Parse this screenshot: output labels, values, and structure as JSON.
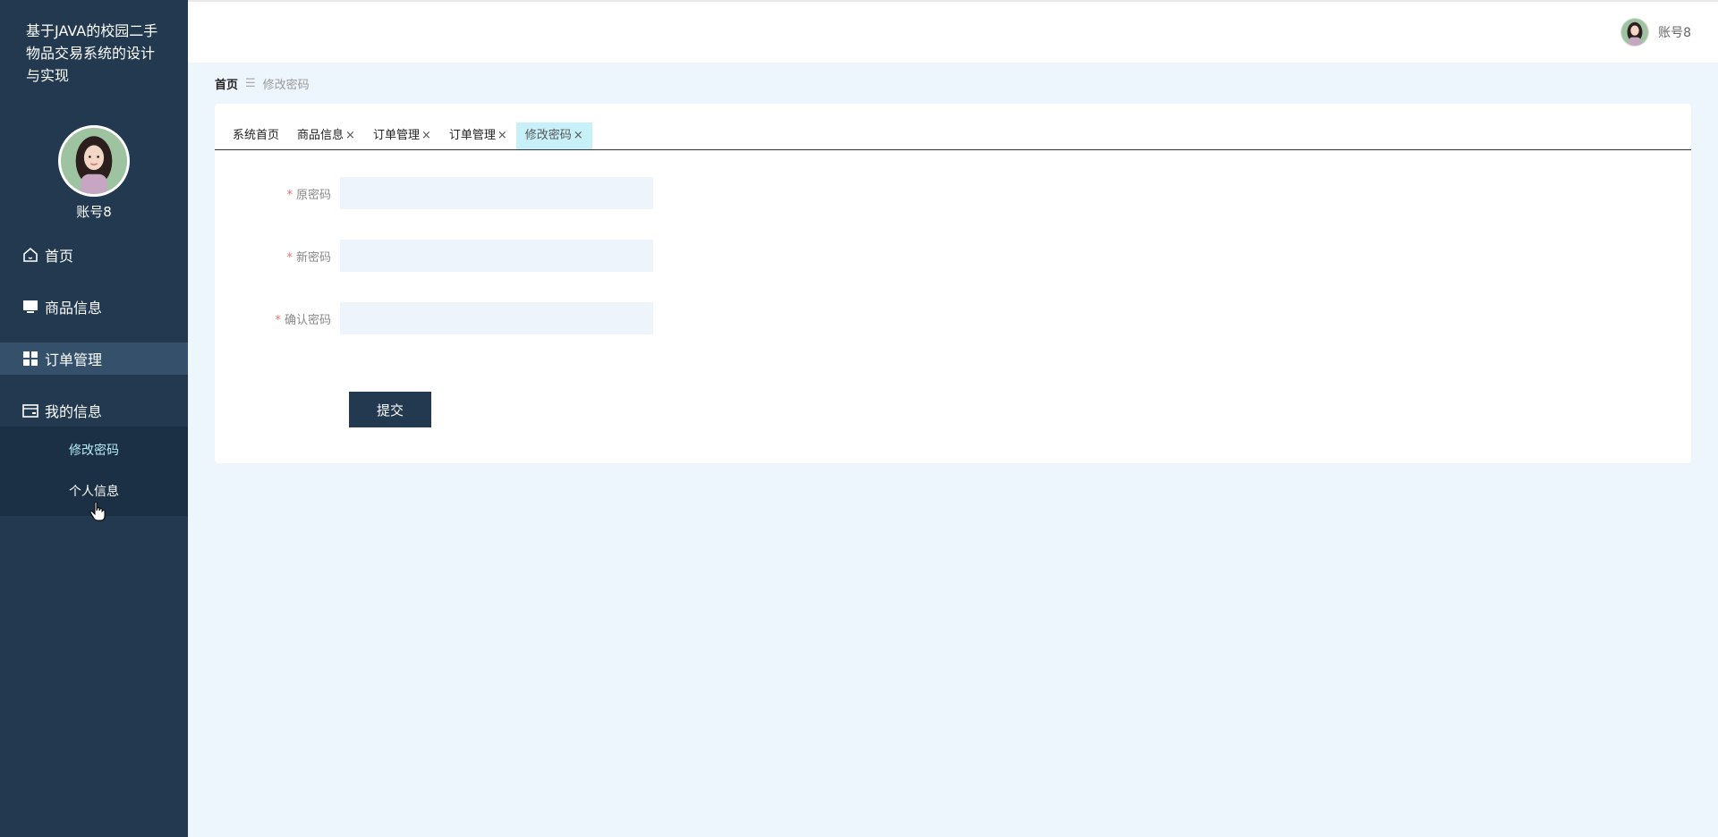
{
  "app": {
    "title": "基于JAVA的校园二手物品交易系统的设计与实现"
  },
  "user": {
    "name": "账号8"
  },
  "sidebar": {
    "items": [
      {
        "label": "首页",
        "icon": "home-icon"
      },
      {
        "label": "商品信息",
        "icon": "monitor-icon"
      },
      {
        "label": "订单管理",
        "icon": "grid-icon"
      },
      {
        "label": "我的信息",
        "icon": "wallet-icon"
      }
    ],
    "submenu": [
      {
        "label": "修改密码"
      },
      {
        "label": "个人信息"
      }
    ]
  },
  "breadcrumb": {
    "home": "首页",
    "separator": "☰",
    "current": "修改密码"
  },
  "tabs": [
    {
      "label": "系统首页",
      "closable": false
    },
    {
      "label": "商品信息",
      "closable": true
    },
    {
      "label": "订单管理",
      "closable": true
    },
    {
      "label": "订单管理",
      "closable": true
    },
    {
      "label": "修改密码",
      "closable": true,
      "active": true
    }
  ],
  "form": {
    "fields": [
      {
        "label": "原密码",
        "required": true,
        "value": ""
      },
      {
        "label": "新密码",
        "required": true,
        "value": ""
      },
      {
        "label": "确认密码",
        "required": true,
        "value": ""
      }
    ],
    "submit_label": "提交"
  },
  "colors": {
    "sidebar_bg": "#22394f",
    "active_tab": "#c7f0f9",
    "page_bg": "#eef6fd",
    "required": "#f56c6c"
  },
  "close_glyph": "×"
}
